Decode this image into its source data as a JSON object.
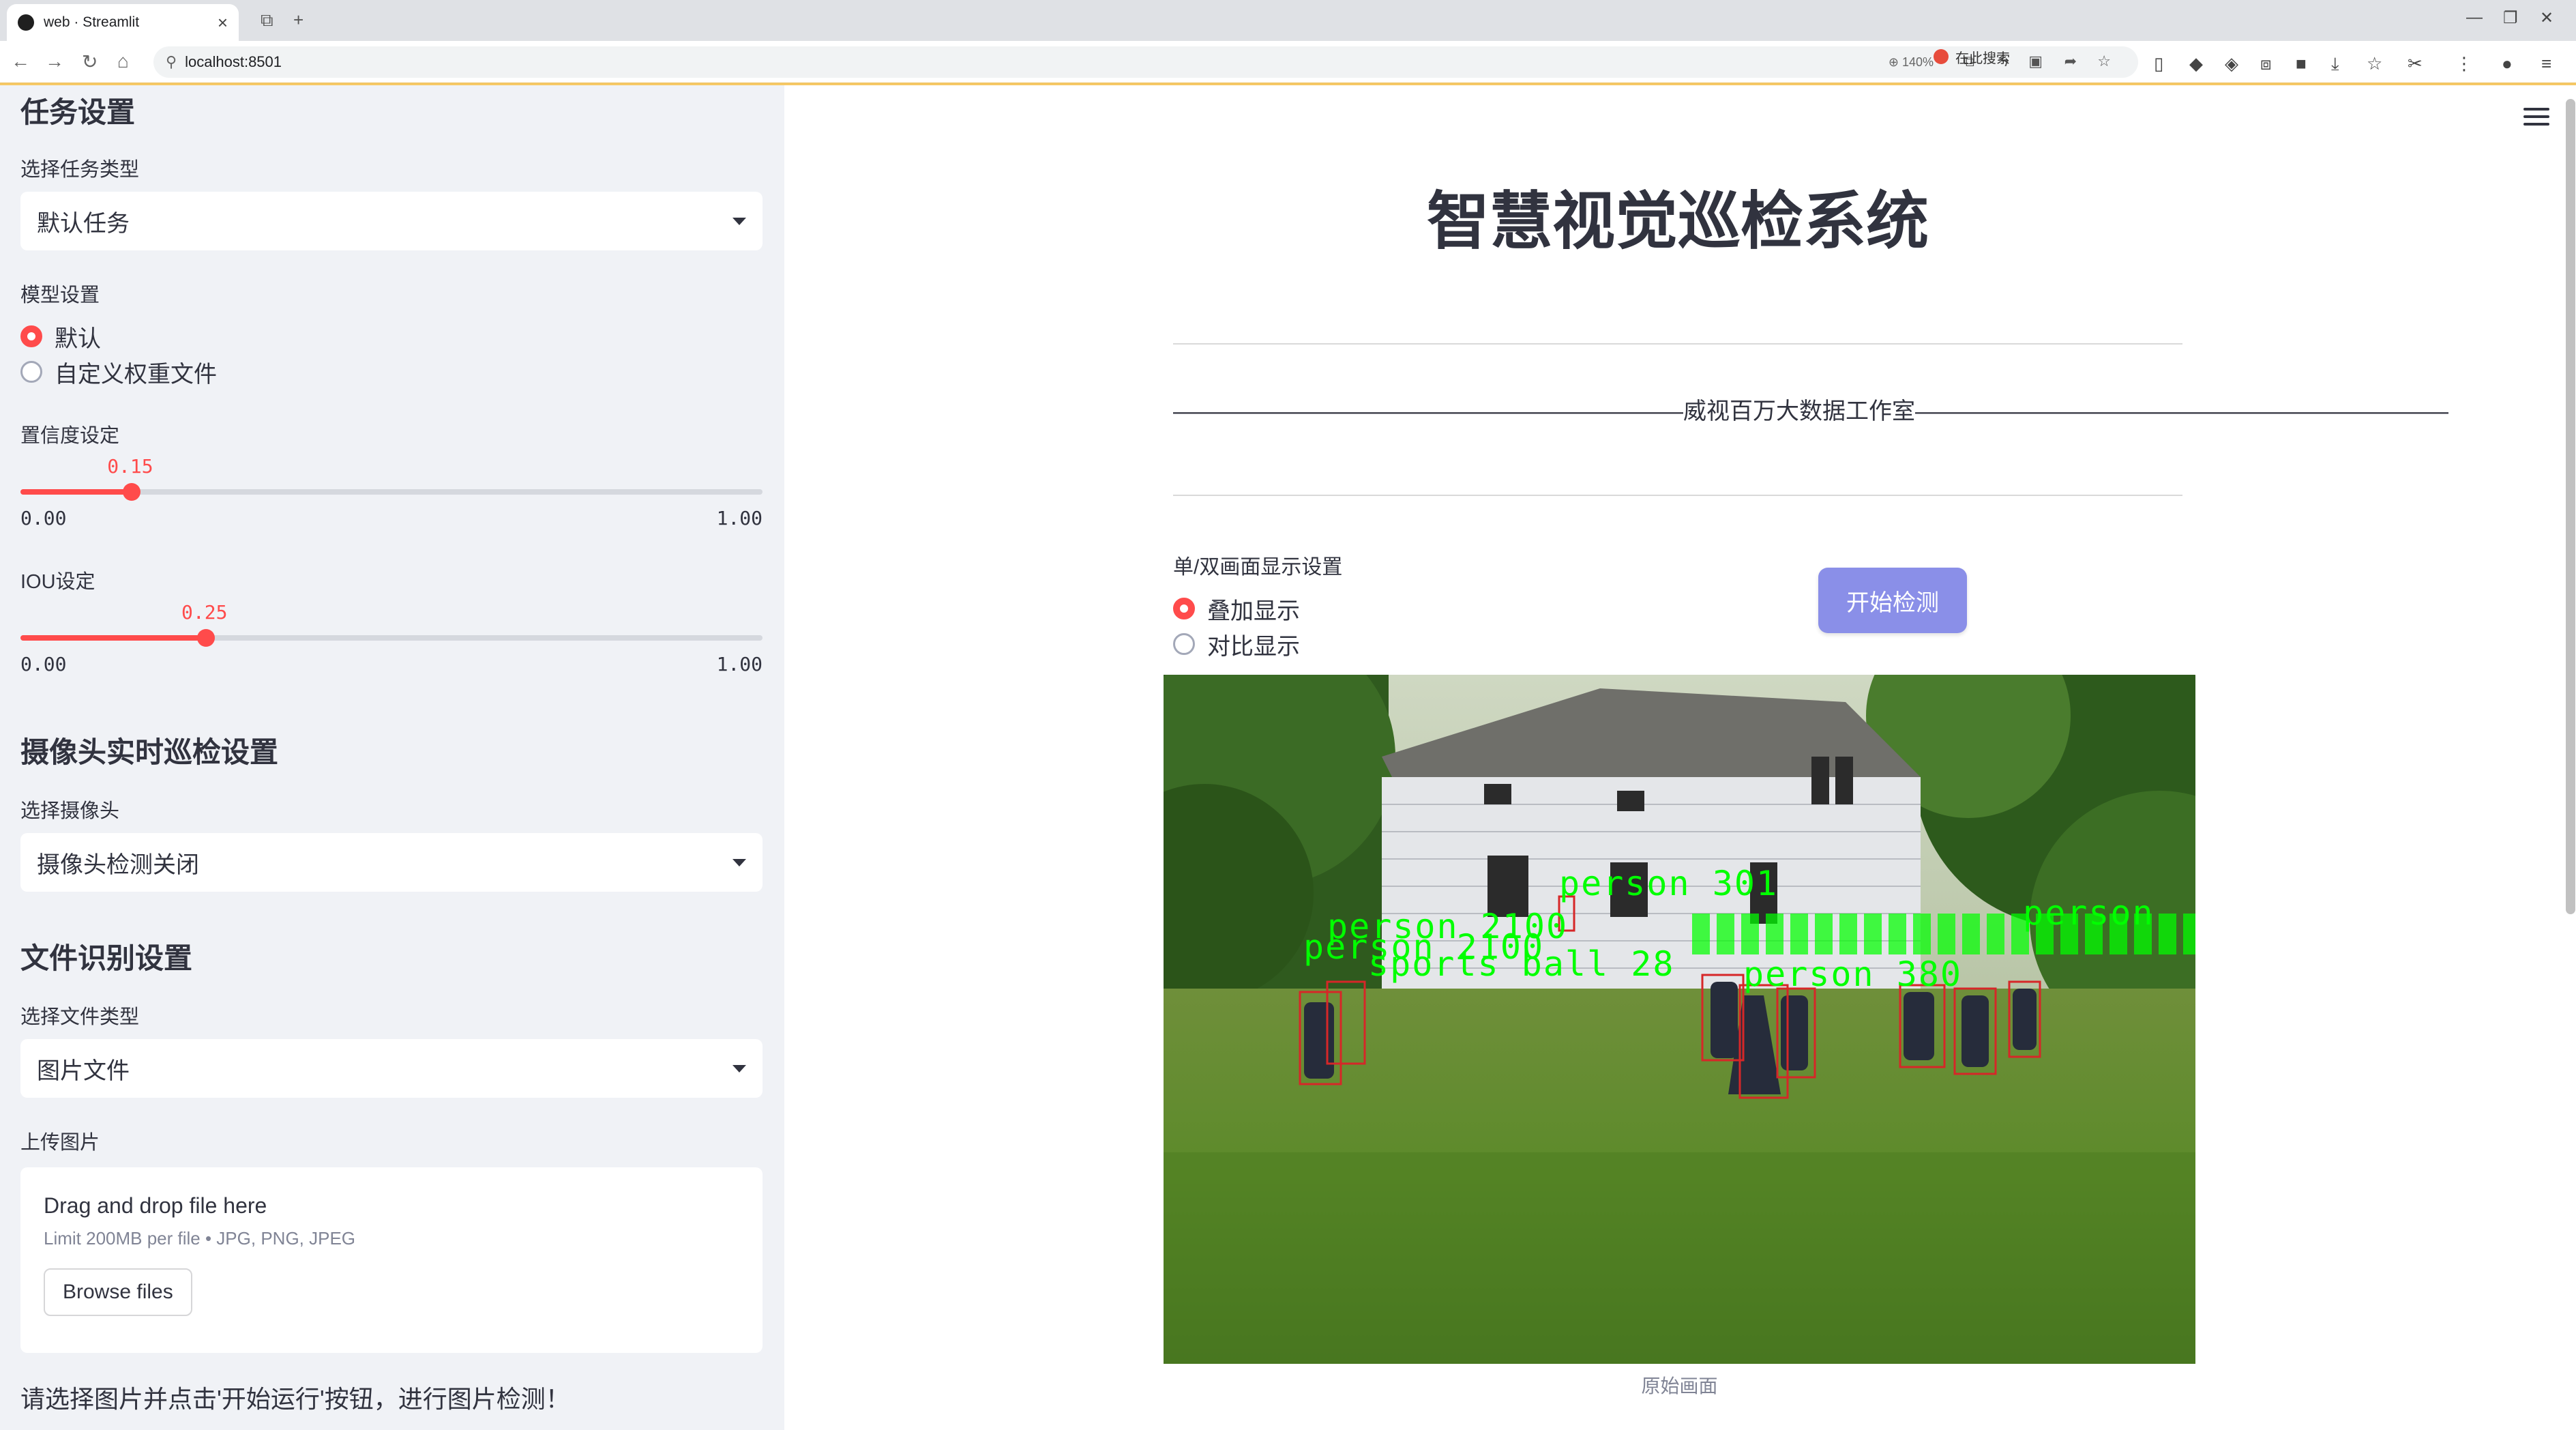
{
  "browser": {
    "tab_title": "web · Streamlit",
    "url": "localhost:8501",
    "zoom": "140%",
    "search_placeholder": "在此搜索"
  },
  "sidebar": {
    "task_heading": "任务设置",
    "task_type_label": "选择任务类型",
    "task_type_value": "默认任务",
    "model_label": "模型设置",
    "model_options": [
      "默认",
      "自定义权重文件"
    ],
    "model_selected": 0,
    "conf_label": "置信度设定",
    "conf_value": "0.15",
    "conf_fraction": 0.15,
    "conf_min": "0.00",
    "conf_max": "1.00",
    "iou_label": "IOU设定",
    "iou_value": "0.25",
    "iou_fraction": 0.25,
    "iou_min": "0.00",
    "iou_max": "1.00",
    "camera_heading": "摄像头实时巡检设置",
    "camera_label": "选择摄像头",
    "camera_value": "摄像头检测关闭",
    "file_heading": "文件识别设置",
    "file_type_label": "选择文件类型",
    "file_type_value": "图片文件",
    "upload_label": "上传图片",
    "upload_title": "Drag and drop file here",
    "upload_limit": "Limit 200MB per file • JPG, PNG, JPEG",
    "browse_label": "Browse files",
    "hint": "请选择图片并点击'开始运行'按钮，进行图片检测！"
  },
  "main": {
    "title": "智慧视觉巡检系统",
    "studio_line": "——————————————————————威视百万大数据工作室———————————————————————",
    "display_label": "单/双画面显示设置",
    "display_options": [
      "叠加显示",
      "对比显示"
    ],
    "display_selected": 0,
    "start_button": "开始检测",
    "image_caption": "原始画面",
    "detection_labels": [
      "person 301",
      "person 2100",
      "person 2100",
      "sports ball 28",
      "person 380",
      "person"
    ]
  },
  "colors": {
    "accent": "#ff4b4b",
    "button": "#8a8fe8",
    "sidebar_bg": "#f0f2f6",
    "detection_text": "#00ff00",
    "detection_box": "#d62728"
  }
}
